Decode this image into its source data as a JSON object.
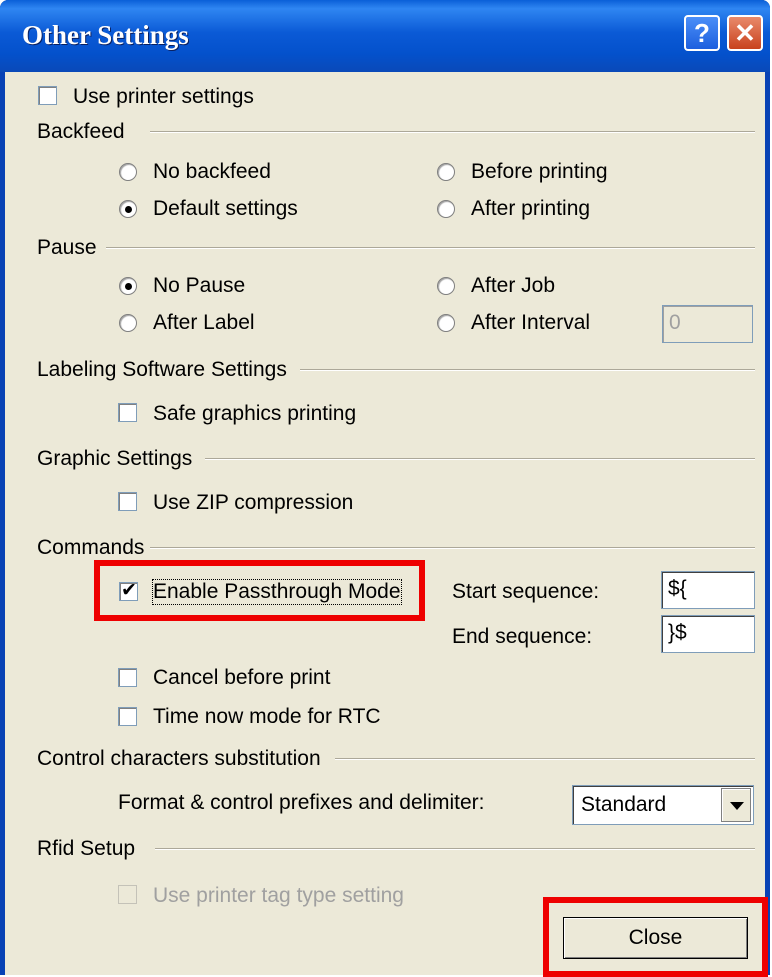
{
  "window": {
    "title": "Other Settings",
    "help_glyph": "?",
    "close_glyph": "✕"
  },
  "use_printer_settings": {
    "label": "Use printer settings",
    "checked": false
  },
  "backfeed": {
    "heading": "Backfeed",
    "options": [
      "No backfeed",
      "Default settings",
      "Before printing",
      "After printing"
    ],
    "selected": "Default settings"
  },
  "pause": {
    "heading": "Pause",
    "options": [
      "No Pause",
      "After Label",
      "After Job",
      "After Interval"
    ],
    "selected": "No Pause",
    "interval_value": "0"
  },
  "labeling": {
    "heading": "Labeling Software Settings",
    "safe_graphics_label": "Safe graphics printing",
    "checked": false
  },
  "graphic": {
    "heading": "Graphic Settings",
    "zip_label": "Use ZIP compression",
    "checked": false
  },
  "commands": {
    "heading": "Commands",
    "passthrough_label": "Enable Passthrough Mode",
    "passthrough_checked": true,
    "start_label": "Start sequence:",
    "start_value": "${",
    "end_label": "End sequence:",
    "end_value": "}$",
    "cancel_label": "Cancel before print",
    "rtc_label": "Time now mode for RTC"
  },
  "control_chars": {
    "heading": "Control characters substitution",
    "prefix_label": "Format & control prefixes and delimiter:",
    "prefix_value": "Standard"
  },
  "rfid": {
    "heading": "Rfid Setup",
    "tag_label": "Use printer tag type setting",
    "disabled": true
  },
  "footer": {
    "close_label": "Close"
  },
  "colors": {
    "title_bar": "#0a5fd8",
    "dialog_bg": "#ece9d8",
    "highlight": "#ee0000"
  }
}
